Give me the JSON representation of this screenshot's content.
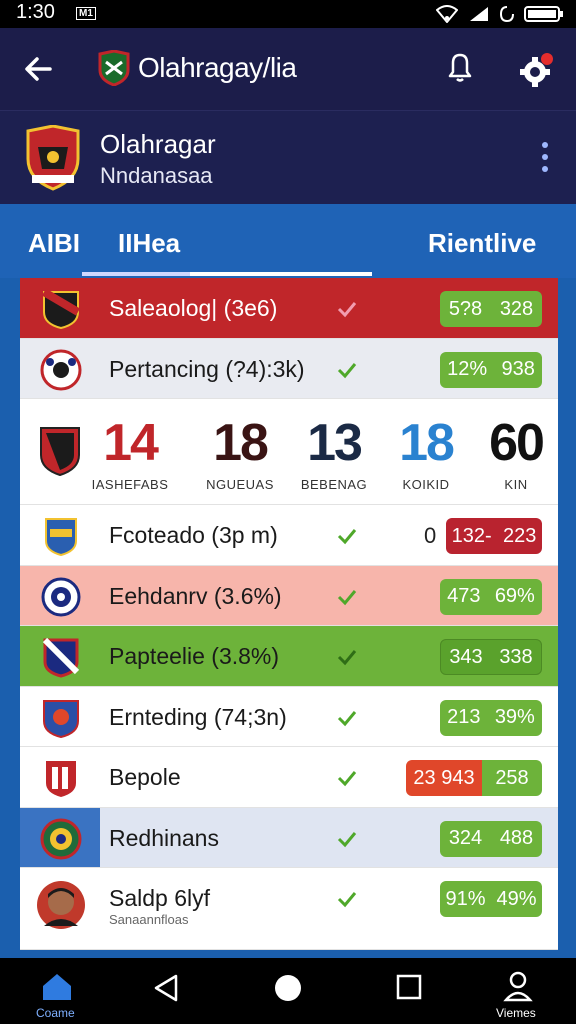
{
  "status": {
    "time": "1:30",
    "sim": "M1"
  },
  "appbar": {
    "title": "Olahragay/lia"
  },
  "club": {
    "name": "Olahragar",
    "subtitle": "Nndanasaa"
  },
  "tabs": [
    {
      "label": "AIBI"
    },
    {
      "label": "IIHea"
    },
    {
      "label": "Rientlive"
    }
  ],
  "rows_top": [
    {
      "label": "Saleaolog| (3e6)",
      "stat_a": "5?8",
      "stat_b": "328"
    },
    {
      "label": "Pertancing (?4):3k)",
      "stat_a": "12%",
      "stat_b": "938"
    }
  ],
  "scores": [
    {
      "value": "14",
      "caption": "IASHEFABS",
      "color": "#c0262a"
    },
    {
      "value": "18",
      "caption": "NGUEUAS",
      "color": "#3a1414"
    },
    {
      "value": "13",
      "caption": "BEBENAG",
      "color": "#1b2a45"
    },
    {
      "value": "18",
      "caption": "KOIKID",
      "color": "#2a82d0"
    },
    {
      "value": "60",
      "caption": "KIN",
      "color": "#111111"
    }
  ],
  "rows_bottom": [
    {
      "label": "Fcoteado (3p m)",
      "prefix": "0",
      "stat_a": "132-",
      "stat_b": "223"
    },
    {
      "label": "Eehdanrv (3.6%)",
      "stat_a": "473",
      "stat_b": "69%"
    },
    {
      "label": "Papteelie (3.8%)",
      "stat_a": "343",
      "stat_b": "338"
    },
    {
      "label": "Ernteding (74;3n)",
      "stat_a": "213",
      "stat_b": "39%"
    },
    {
      "label": "Bepole",
      "stat_a": "23 943",
      "stat_b": "258"
    },
    {
      "label": "Redhinans",
      "stat_a": "324",
      "stat_b": "488"
    },
    {
      "label": "Saldp 6lyf",
      "sublabel": "Sanaannfloas",
      "stat_a": "91%",
      "stat_b": "49%"
    }
  ],
  "nav": {
    "home_label": "Coame",
    "profile_label": "Viemes"
  },
  "colors": {
    "accent": "#1f63b6",
    "header": "#1c1d4a",
    "stat_green": "#6db33a",
    "red": "#c0262a"
  }
}
